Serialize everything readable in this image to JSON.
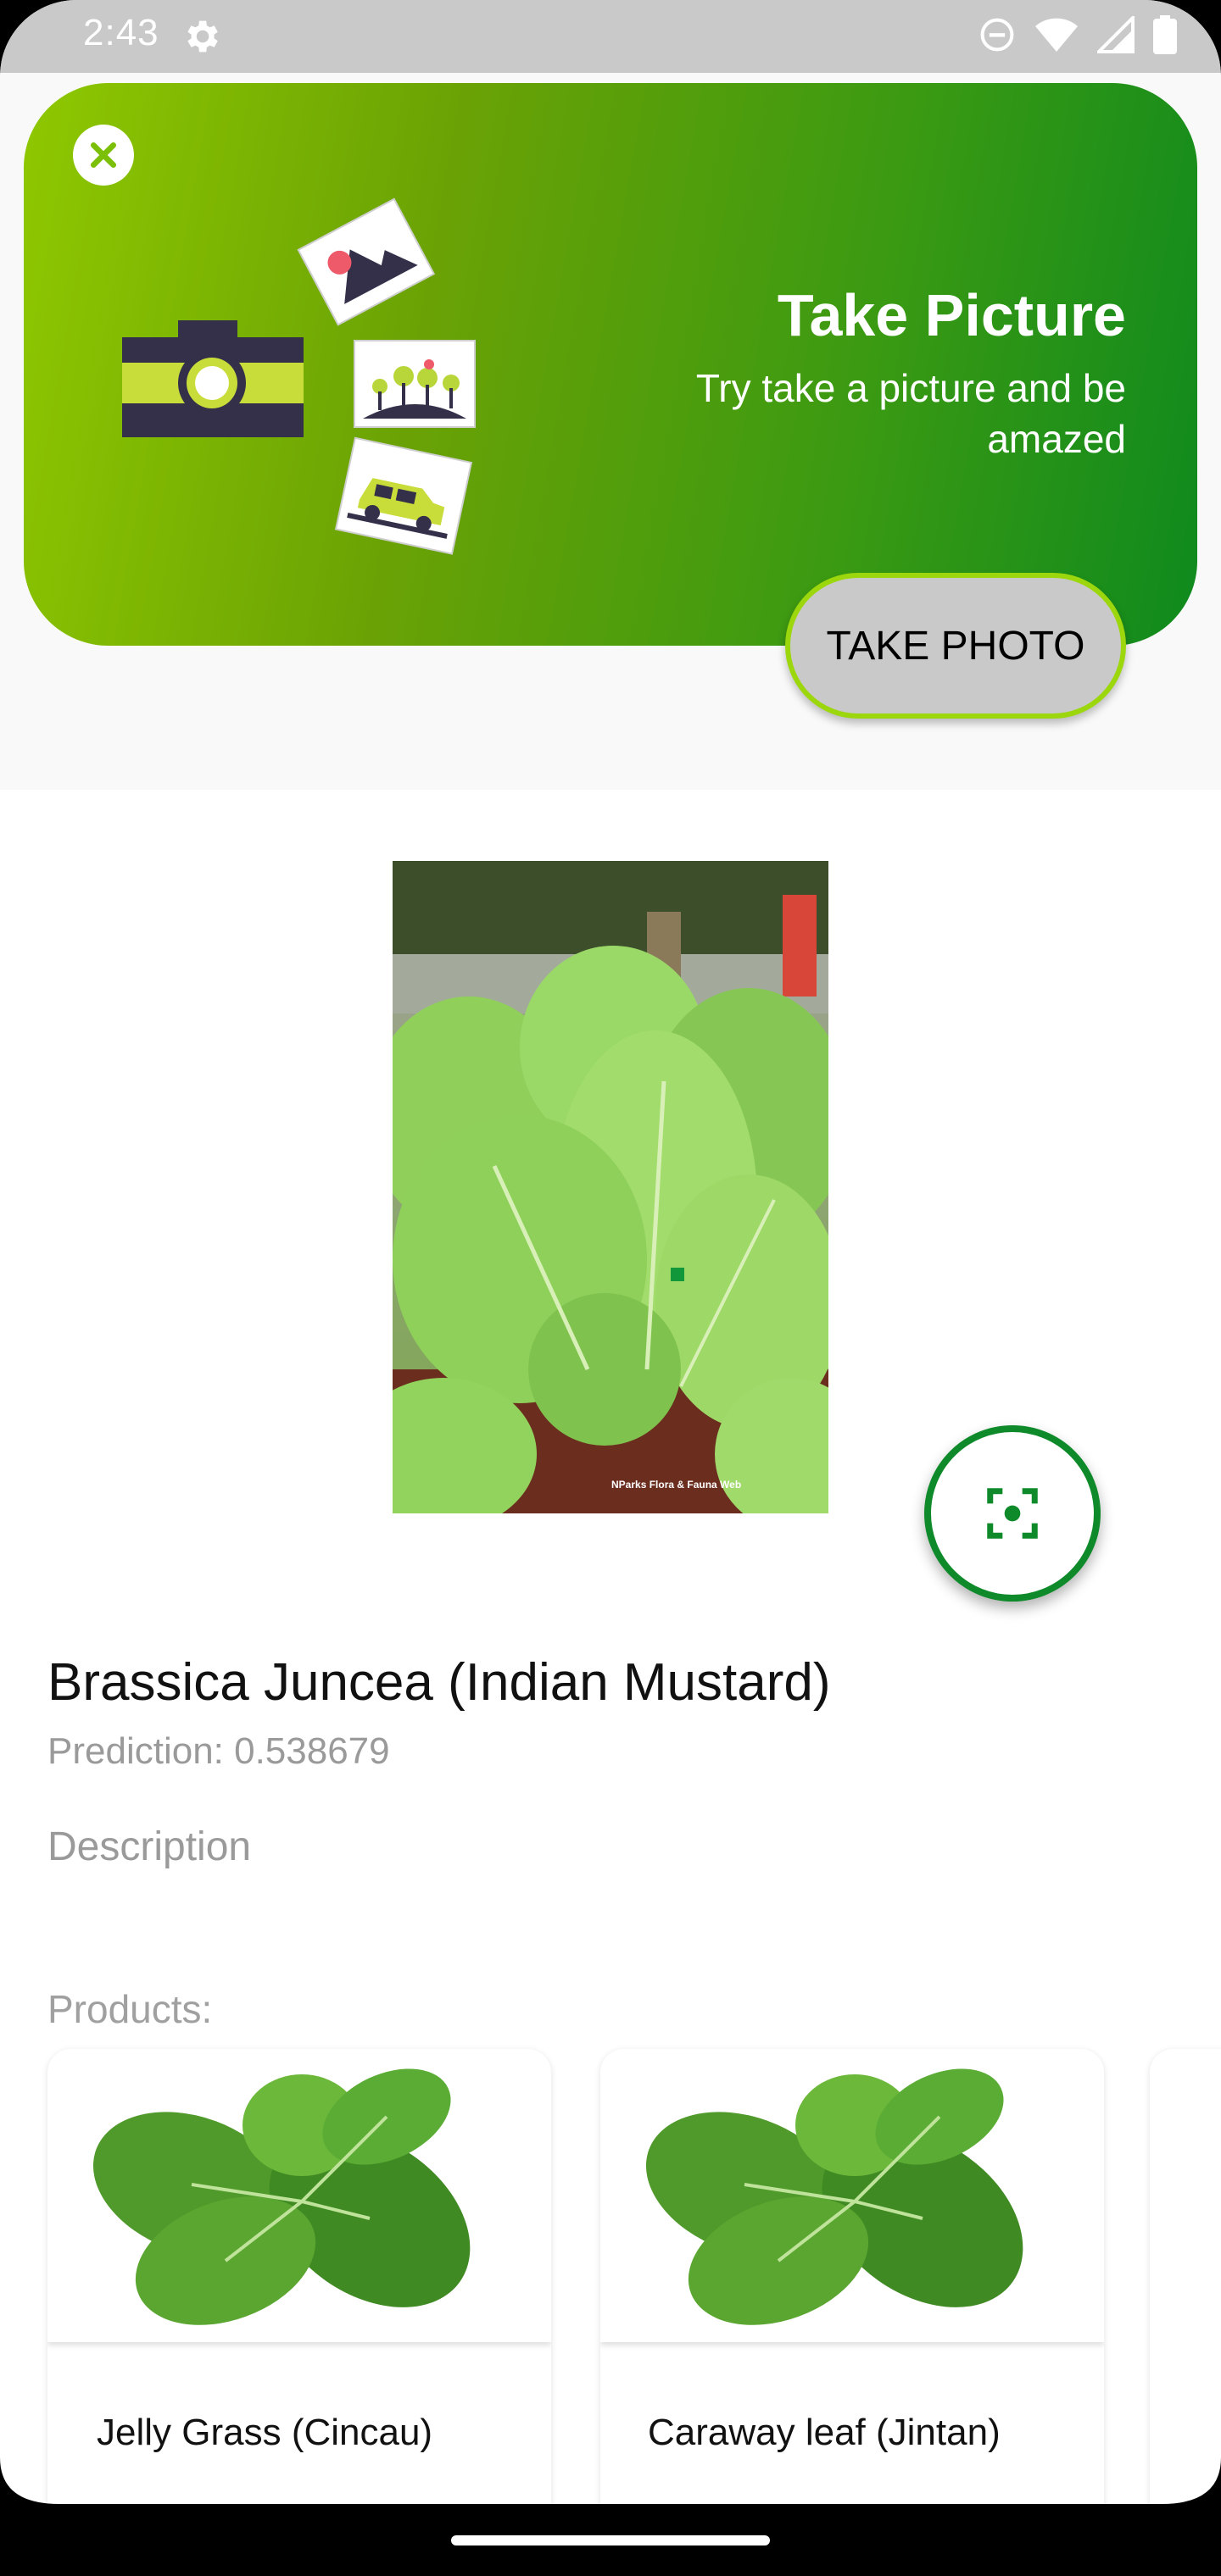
{
  "status_bar": {
    "time": "2:43"
  },
  "banner": {
    "title": "Take Picture",
    "subtitle": "Try take a picture and be amazed",
    "take_photo_label": "TAKE PHOTO"
  },
  "result": {
    "plant_name": "Brassica Juncea (Indian Mustard)",
    "prediction": "Prediction: 0.538679",
    "description_label": "Description",
    "photo_watermark": "NParks Flora & Fauna Web"
  },
  "products": {
    "label": "Products:",
    "items": [
      {
        "name": "Jelly Grass (Cincau)"
      },
      {
        "name": "Caraway leaf (Jintan)"
      }
    ]
  },
  "colors": {
    "accent_green": "#0f8a2a",
    "banner_start": "#8fc800",
    "banner_end": "#0f8a1e"
  }
}
